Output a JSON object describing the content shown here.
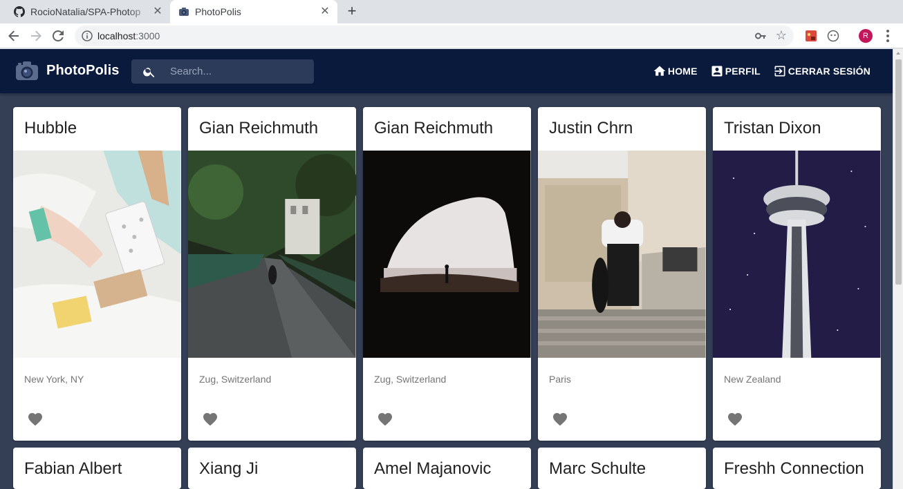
{
  "browser": {
    "tabs": [
      {
        "title": "RocioNatalia/SPA-Photop",
        "icon": "github-icon",
        "active": false
      },
      {
        "title": "PhotoPolis",
        "icon": "camera-icon",
        "active": true
      }
    ],
    "new_tab_label": "+",
    "close_glyph": "✕",
    "url_host": "localhost",
    "url_port": ":3000",
    "profile_initial": "R"
  },
  "app": {
    "brand": "PhotoPolis",
    "search_placeholder": "Search...",
    "nav": [
      {
        "label": "HOME",
        "icon": "home-icon"
      },
      {
        "label": "PERFIL",
        "icon": "account-box-icon"
      },
      {
        "label": "CERRAR SESIÓN",
        "icon": "exit-to-app-icon"
      }
    ]
  },
  "cards": [
    {
      "title": "Hubble",
      "location": "New York, NY",
      "photo": "bed-sheets-and-boxes"
    },
    {
      "title": "Gian Reichmuth",
      "location": "Zug, Switzerland",
      "photo": "skater-on-forest-path"
    },
    {
      "title": "Gian Reichmuth",
      "location": "Zug, Switzerland",
      "photo": "cave-opening-at-sea"
    },
    {
      "title": "Justin Chrn",
      "location": "Paris",
      "photo": "skateboarder-on-stairs"
    },
    {
      "title": "Tristan Dixon",
      "location": "New Zealand",
      "photo": "sky-tower-at-night"
    }
  ],
  "cards_row2": [
    {
      "title": "Fabian Albert"
    },
    {
      "title": "Xiang Ji"
    },
    {
      "title": "Amel Majanovic"
    },
    {
      "title": "Marc Schulte"
    },
    {
      "title": "Freshh Connection"
    }
  ],
  "colors": {
    "appbar": "#0a1a3d",
    "page_bg": "#343f56",
    "search_bg": "#2d3b5b",
    "favorite_icon": "#757575"
  }
}
